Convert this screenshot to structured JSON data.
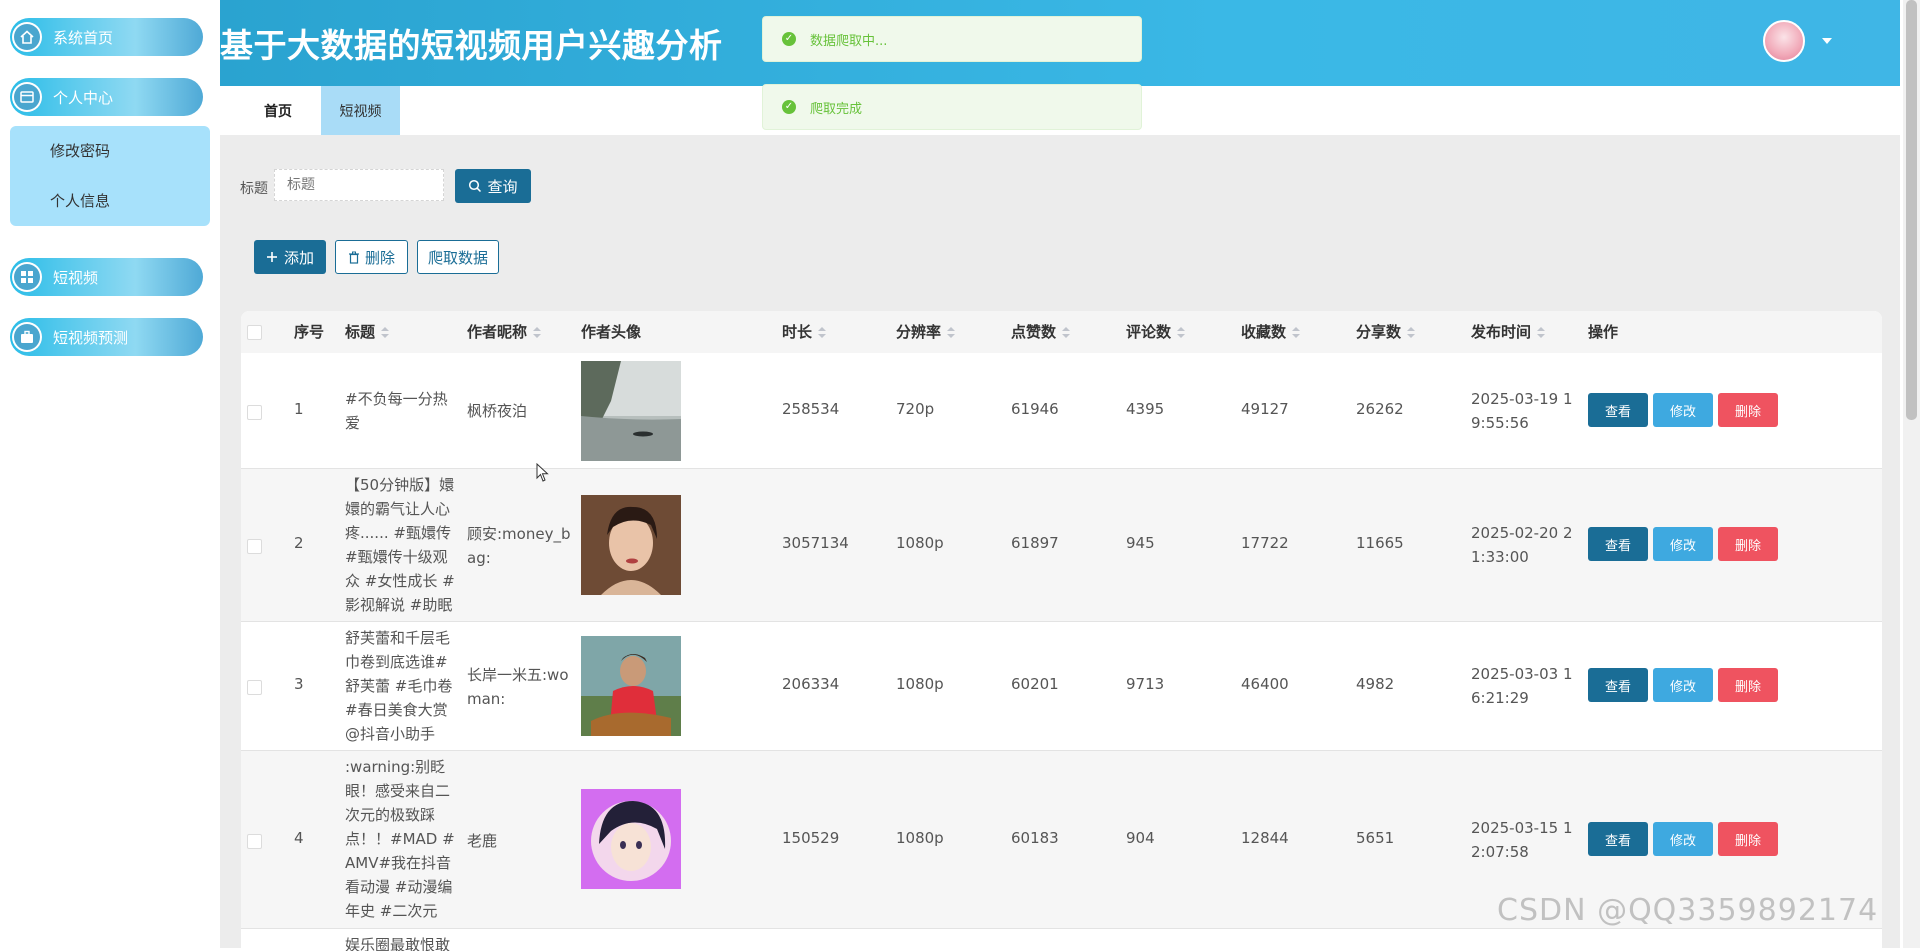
{
  "sidebar": {
    "items": [
      {
        "label": "系统首页",
        "icon": "home-icon"
      },
      {
        "label": "个人中心",
        "icon": "profile-icon"
      },
      {
        "label": "短视频",
        "icon": "grid-icon"
      },
      {
        "label": "短视频预测",
        "icon": "briefcase-icon"
      }
    ],
    "submenu": [
      {
        "label": "修改密码"
      },
      {
        "label": "个人信息"
      }
    ]
  },
  "header": {
    "title": "基于大数据的短视频用户兴趣分析",
    "avatar_icon": "user-avatar",
    "caret_icon": "caret-down-icon"
  },
  "tabs": [
    {
      "label": "首页"
    },
    {
      "label": "短视频"
    }
  ],
  "toasts": [
    {
      "text": "数据爬取中..."
    },
    {
      "text": "爬取完成"
    }
  ],
  "search": {
    "label": "标题",
    "placeholder": "标题",
    "query_label": "查询"
  },
  "toolbar": {
    "add_label": "添加",
    "delete_label": "删除",
    "crawl_label": "爬取数据"
  },
  "table": {
    "columns": [
      "序号",
      "标题",
      "作者昵称",
      "作者头像",
      "时长",
      "分辨率",
      "点赞数",
      "评论数",
      "收藏数",
      "分享数",
      "发布时间",
      "操作"
    ],
    "action_labels": {
      "view": "查看",
      "edit": "修改",
      "delete": "删除"
    },
    "rows": [
      {
        "index": "1",
        "title": "#不负每一分热爱",
        "author": "枫桥夜泊",
        "duration": "258534",
        "resolution": "720p",
        "likes": "61946",
        "comments": "4395",
        "favorites": "49127",
        "shares": "26262",
        "published": "2025-03-19 19:55:56"
      },
      {
        "index": "2",
        "title": "【50分钟版】嬛嬛的霸气让人心疼...... #甄嬛传 #甄嬛传十级观众 #女性成长 #影视解说 #助眠",
        "author": "顾安:money_bag:",
        "duration": "3057134",
        "resolution": "1080p",
        "likes": "61897",
        "comments": "945",
        "favorites": "17722",
        "shares": "11665",
        "published": "2025-02-20 21:33:00"
      },
      {
        "index": "3",
        "title": "舒芙蕾和千层毛巾卷到底选谁#舒芙蕾 #毛巾卷 #春日美食大赏 @抖音小助手",
        "author": "长岸一米五:woman:",
        "duration": "206334",
        "resolution": "1080p",
        "likes": "60201",
        "comments": "9713",
        "favorites": "46400",
        "shares": "4982",
        "published": "2025-03-03 16:21:29"
      },
      {
        "index": "4",
        "title": ":warning:别眨眼！感受来自二次元的极致踩点！！#MAD #AMV#我在抖音看动漫 #动漫编年史 #二次元",
        "author": "老鹿",
        "duration": "150529",
        "resolution": "1080p",
        "likes": "60183",
        "comments": "904",
        "favorites": "12844",
        "shares": "5651",
        "published": "2025-03-15 12:07:58"
      },
      {
        "index": "",
        "title": "娱乐圈最敢恨敢",
        "author": "",
        "duration": "",
        "resolution": "",
        "likes": "",
        "comments": "",
        "favorites": "",
        "shares": "",
        "published": ""
      }
    ]
  },
  "watermark": "CSDN @QQ3359892174"
}
